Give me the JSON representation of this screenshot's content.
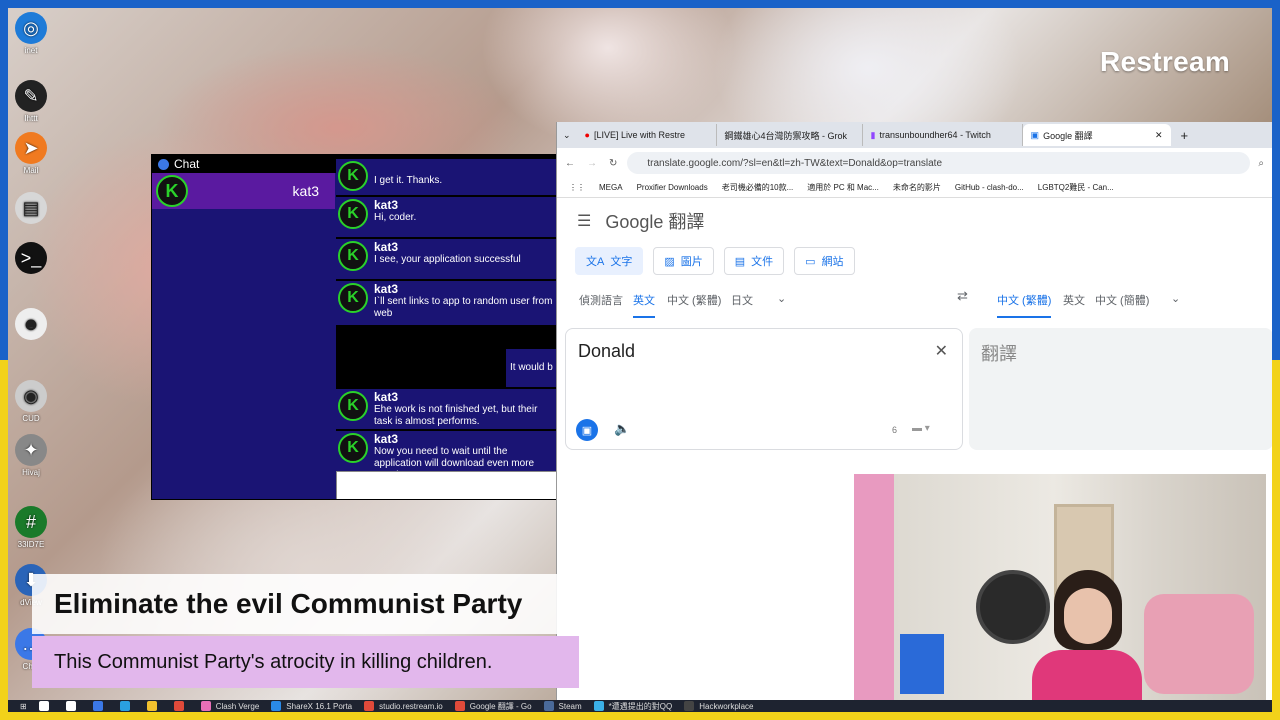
{
  "overlay": {
    "brand": "Restream"
  },
  "desktop_icons": [
    {
      "label": "inet",
      "icon": "globe-icon",
      "color": "#1e7bd8"
    },
    {
      "label": "Ihttt",
      "icon": "feather-icon",
      "color": "#222222"
    },
    {
      "label": "Mail",
      "icon": "send-icon",
      "color": "#f07a20"
    },
    {
      "label": "",
      "icon": "notepad-icon",
      "color": "#d7d7d7"
    },
    {
      "label": "",
      "icon": "terminal-icon",
      "color": "#111111"
    },
    {
      "label": "",
      "icon": "cat-icon",
      "color": "#eeeeee"
    },
    {
      "label": "CUD",
      "icon": "disk-icon",
      "color": "#cccccc"
    },
    {
      "label": "Hivaj",
      "icon": "compass-icon",
      "color": "#888888"
    },
    {
      "label": "33ID7E",
      "icon": "hash-icon",
      "color": "#1a7a2a"
    },
    {
      "label": "dView",
      "icon": "download-icon",
      "color": "#2a64b8"
    },
    {
      "label": "Chat",
      "icon": "chat-icon",
      "color": "#3b78e7"
    }
  ],
  "chat": {
    "title": "Chat",
    "contact": {
      "avatar": "K",
      "name": "kat3"
    },
    "messages": [
      {
        "who": "",
        "text": "I get it. Thanks."
      },
      {
        "who": "kat3",
        "text": "Hi, coder."
      },
      {
        "who": "kat3",
        "text": "I see, your application successful"
      },
      {
        "who": "kat3",
        "text": "I`ll sent links to app to random user from web"
      },
      {
        "who": "kat3",
        "text": "Ehe work is not finished yet, but their task is almost performs."
      },
      {
        "who": "kat3",
        "text": "Now you need to wait until the application will download even more people"
      }
    ],
    "own_message": "It would b"
  },
  "browser": {
    "tabs": [
      {
        "label": "[LIVE] Live with Restre",
        "active": false
      },
      {
        "label": "鋼鐵雄心4台灣防禦攻略 - Grok",
        "active": false
      },
      {
        "label": "transunboundher64 - Twitch",
        "active": false
      },
      {
        "label": "Google 翻譯",
        "active": true
      }
    ],
    "url": "translate.google.com/?sl=en&tl=zh-TW&text=Donald&op=translate",
    "bookmarks": [
      "MEGA",
      "Proxifier Downloads",
      "老司機必備的10款...",
      "適用於 PC 和 Mac...",
      "未命名的影片",
      "GitHub - clash-do...",
      "LGBTQ2難民 - Can..."
    ],
    "page": {
      "logo": "Google 翻譯",
      "modes": [
        "文字",
        "圖片",
        "文件",
        "網站"
      ],
      "source_langs": [
        "偵測語言",
        "英文",
        "中文 (繁體)",
        "日文"
      ],
      "target_langs": [
        "中文 (繁體)",
        "英文",
        "中文 (簡體)"
      ],
      "source_text": "Donald",
      "target_placeholder": "翻譯",
      "char_count": "6"
    }
  },
  "captions": {
    "headline": "Eliminate the evil Communist Party",
    "subline": "This  Communist Party's atrocity in killing children."
  },
  "taskbar": [
    {
      "label": "",
      "color": "#ffffff"
    },
    {
      "label": "",
      "color": "#ffffff"
    },
    {
      "label": "",
      "color": "#3b78e7"
    },
    {
      "label": "",
      "color": "#2aa0e0"
    },
    {
      "label": "",
      "color": "#f2c12e"
    },
    {
      "label": "",
      "color": "#e04a3a"
    },
    {
      "label": "Clash Verge",
      "color": "#e86fb8"
    },
    {
      "label": "ShareX 16.1 Porta",
      "color": "#2a8ae8"
    },
    {
      "label": "studio.restream.io",
      "color": "#e04a3a"
    },
    {
      "label": "Google 翻譯 - Go",
      "color": "#e04a3a"
    },
    {
      "label": "Steam",
      "color": "#4a6a9a"
    },
    {
      "label": "*遭遇提出的對QQ",
      "color": "#3bb0e7"
    },
    {
      "label": "Hackworkplace",
      "color": "#444444"
    }
  ]
}
